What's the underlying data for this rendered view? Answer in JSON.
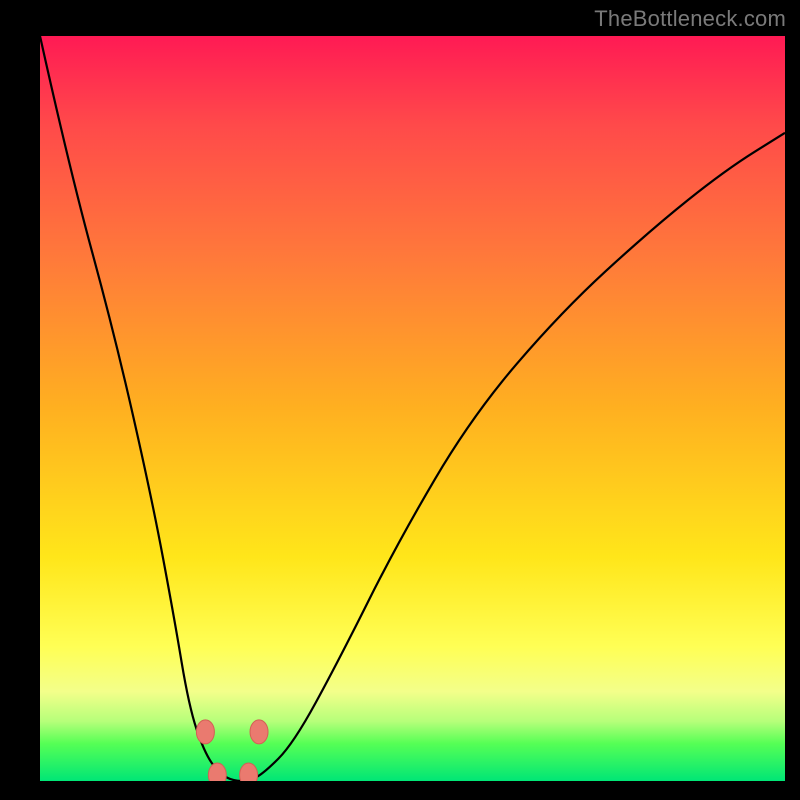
{
  "watermark": "TheBottleneck.com",
  "colors": {
    "frame": "#000000",
    "curve": "#000000",
    "marker_fill": "#ea7a6f",
    "marker_stroke": "#d36055"
  },
  "chart_data": {
    "type": "line",
    "title": "",
    "xlabel": "",
    "ylabel": "",
    "xlim": [
      0,
      100
    ],
    "ylim": [
      0,
      100
    ],
    "grid": false,
    "legend": false,
    "series": [
      {
        "name": "bottleneck-curve",
        "x": [
          0,
          4,
          10,
          15,
          18,
          20,
          22,
          24,
          26,
          28,
          30,
          34,
          40,
          48,
          58,
          70,
          82,
          92,
          100
        ],
        "y": [
          100,
          82,
          60,
          38,
          22,
          10,
          4,
          1,
          0,
          0,
          1,
          5,
          16,
          32,
          49,
          63,
          74,
          82,
          87
        ]
      }
    ],
    "markers": [
      {
        "x": 22.2,
        "y": 6.6
      },
      {
        "x": 29.4,
        "y": 6.6
      },
      {
        "x": 23.8,
        "y": 0.8
      },
      {
        "x": 28.0,
        "y": 0.8
      }
    ],
    "background_gradient": [
      {
        "stop": 0,
        "color": "#ff1a54"
      },
      {
        "stop": 50,
        "color": "#ffb020"
      },
      {
        "stop": 82,
        "color": "#ffff55"
      },
      {
        "stop": 100,
        "color": "#00e676"
      }
    ]
  }
}
